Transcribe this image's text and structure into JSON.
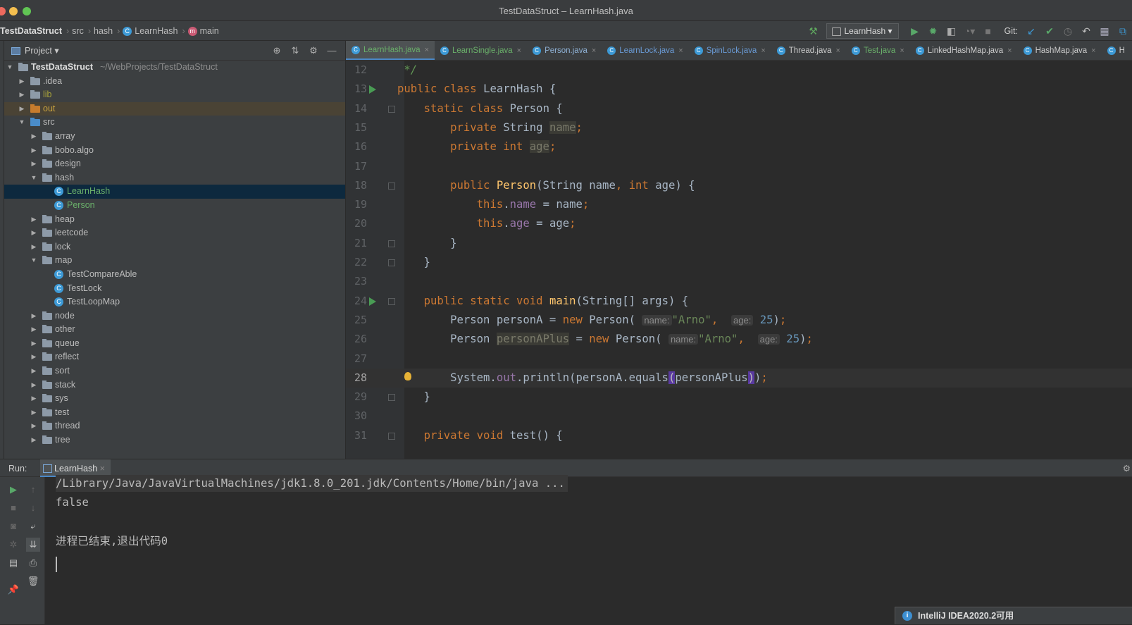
{
  "window": {
    "title": "TestDataStruct – LearnHash.java"
  },
  "navbar": {
    "crumbs": [
      "TestDataStruct",
      "src",
      "hash",
      "LearnHash",
      "main"
    ],
    "run_config": "LearnHash",
    "git_label": "Git:"
  },
  "project": {
    "title": "Project",
    "root": {
      "name": "TestDataStruct",
      "path": "~/WebProjects/TestDataStruct"
    },
    "tree": [
      {
        "label": ".idea",
        "kind": "folder",
        "expanded": false
      },
      {
        "label": "lib",
        "kind": "lib",
        "expanded": false
      },
      {
        "label": "out",
        "kind": "out",
        "expanded": false
      },
      {
        "label": "src",
        "kind": "src",
        "expanded": true
      },
      {
        "label": "array",
        "kind": "pkg",
        "expanded": false
      },
      {
        "label": "bobo.algo",
        "kind": "pkg",
        "expanded": false
      },
      {
        "label": "design",
        "kind": "pkg",
        "expanded": false
      },
      {
        "label": "hash",
        "kind": "pkg",
        "expanded": true
      },
      {
        "label": "LearnHash",
        "kind": "class-main",
        "selected": true
      },
      {
        "label": "Person",
        "kind": "class"
      },
      {
        "label": "heap",
        "kind": "pkg",
        "expanded": false
      },
      {
        "label": "leetcode",
        "kind": "pkg",
        "expanded": false
      },
      {
        "label": "lock",
        "kind": "pkg",
        "expanded": false
      },
      {
        "label": "map",
        "kind": "pkg",
        "expanded": true
      },
      {
        "label": "TestCompareAble",
        "kind": "class-main"
      },
      {
        "label": "TestLock",
        "kind": "class-main"
      },
      {
        "label": "TestLoopMap",
        "kind": "class-main"
      },
      {
        "label": "node",
        "kind": "pkg",
        "expanded": false
      },
      {
        "label": "other",
        "kind": "pkg",
        "expanded": false
      },
      {
        "label": "queue",
        "kind": "pkg",
        "expanded": false
      },
      {
        "label": "reflect",
        "kind": "pkg",
        "expanded": false
      },
      {
        "label": "sort",
        "kind": "pkg",
        "expanded": false
      },
      {
        "label": "stack",
        "kind": "pkg",
        "expanded": false
      },
      {
        "label": "sys",
        "kind": "pkg",
        "expanded": false
      },
      {
        "label": "test",
        "kind": "pkg",
        "expanded": false
      },
      {
        "label": "thread",
        "kind": "pkg",
        "expanded": false
      },
      {
        "label": "tree",
        "kind": "pkg",
        "expanded": false
      }
    ]
  },
  "tabs": [
    {
      "label": "LearnHash.java",
      "active": true
    },
    {
      "label": "LearnSingle.java"
    },
    {
      "label": "Person.java"
    },
    {
      "label": "LearnLock.java"
    },
    {
      "label": "SpinLock.java"
    },
    {
      "label": "Thread.java"
    },
    {
      "label": "Test.java"
    },
    {
      "label": "LinkedHashMap.java"
    },
    {
      "label": "HashMap.java"
    },
    {
      "label": "H"
    }
  ],
  "editor": {
    "current_line": 28,
    "lines": [
      {
        "n": "12",
        "tokens": [
          [
            "cmt",
            " */"
          ]
        ]
      },
      {
        "n": "13",
        "run": true,
        "tokens": [
          [
            "kw",
            "public class "
          ],
          [
            "cls",
            "LearnHash {"
          ]
        ]
      },
      {
        "n": "14",
        "fold": true,
        "tokens": [
          [
            "cls",
            "    "
          ],
          [
            "kw",
            "static class "
          ],
          [
            "cls",
            "Person {"
          ]
        ]
      },
      {
        "n": "15",
        "tokens": [
          [
            "cls",
            "        "
          ],
          [
            "kw",
            "private "
          ],
          [
            "cls",
            "String "
          ],
          [
            "unused",
            "name"
          ],
          [
            "kw",
            ";"
          ]
        ]
      },
      {
        "n": "16",
        "tokens": [
          [
            "cls",
            "        "
          ],
          [
            "kw",
            "private int "
          ],
          [
            "unused",
            "age"
          ],
          [
            "kw",
            ";"
          ]
        ]
      },
      {
        "n": "17",
        "tokens": []
      },
      {
        "n": "18",
        "fold": true,
        "tokens": [
          [
            "cls",
            "        "
          ],
          [
            "kw",
            "public "
          ],
          [
            "fn",
            "Person"
          ],
          [
            "cls",
            "(String name"
          ],
          [
            "kw",
            ", int "
          ],
          [
            "cls",
            "age) {"
          ]
        ]
      },
      {
        "n": "19",
        "tokens": [
          [
            "cls",
            "            "
          ],
          [
            "kw",
            "this"
          ],
          [
            "cls",
            "."
          ],
          [
            "fld",
            "name"
          ],
          [
            "cls",
            " = name"
          ],
          [
            "kw",
            ";"
          ]
        ]
      },
      {
        "n": "20",
        "tokens": [
          [
            "cls",
            "            "
          ],
          [
            "kw",
            "this"
          ],
          [
            "cls",
            "."
          ],
          [
            "fld",
            "age"
          ],
          [
            "cls",
            " = age"
          ],
          [
            "kw",
            ";"
          ]
        ]
      },
      {
        "n": "21",
        "fold": true,
        "tokens": [
          [
            "cls",
            "        }"
          ]
        ]
      },
      {
        "n": "22",
        "fold": true,
        "tokens": [
          [
            "cls",
            "    }"
          ]
        ]
      },
      {
        "n": "23",
        "tokens": []
      },
      {
        "n": "24",
        "run": true,
        "fold": true,
        "tokens": [
          [
            "cls",
            "    "
          ],
          [
            "kw",
            "public static void "
          ],
          [
            "fn",
            "main"
          ],
          [
            "cls",
            "(String[] args) {"
          ]
        ]
      },
      {
        "n": "25",
        "tokens": [
          [
            "cls",
            "        Person personA = "
          ],
          [
            "kw",
            "new "
          ],
          [
            "cls",
            "Person( "
          ],
          [
            "hint",
            "name:"
          ],
          [
            "str",
            "\"Arno\""
          ],
          [
            "kw",
            ",  "
          ],
          [
            "hint",
            "age:"
          ],
          [
            "num",
            " 25"
          ],
          [
            "cls",
            ")"
          ],
          [
            "kw",
            ";"
          ]
        ]
      },
      {
        "n": "26",
        "tokens": [
          [
            "cls",
            "        Person "
          ],
          [
            "unused",
            "personAPlus"
          ],
          [
            "cls",
            " = "
          ],
          [
            "kw",
            "new "
          ],
          [
            "cls",
            "Person( "
          ],
          [
            "hint",
            "name:"
          ],
          [
            "str",
            "\"Arno\""
          ],
          [
            "kw",
            ",  "
          ],
          [
            "hint",
            "age:"
          ],
          [
            "num",
            " 25"
          ],
          [
            "cls",
            ")"
          ],
          [
            "kw",
            ";"
          ]
        ]
      },
      {
        "n": "27",
        "tokens": []
      },
      {
        "n": "28",
        "bulb": true,
        "tokens": [
          [
            "cls",
            "        System."
          ],
          [
            "fld",
            "out"
          ],
          [
            "cls",
            ".println(personA.equals"
          ],
          [
            "brace",
            "("
          ],
          [
            "cls",
            "personAPlus"
          ],
          [
            "brace",
            ")"
          ],
          [
            "cls",
            ")"
          ],
          [
            "kw",
            ";"
          ]
        ]
      },
      {
        "n": "29",
        "fold": true,
        "tokens": [
          [
            "cls",
            "    }"
          ]
        ]
      },
      {
        "n": "30",
        "tokens": []
      },
      {
        "n": "31",
        "fold": true,
        "tokens": [
          [
            "cls",
            "    "
          ],
          [
            "kw",
            "private void "
          ],
          [
            "cls",
            "test() {"
          ]
        ]
      }
    ]
  },
  "run": {
    "label": "Run:",
    "tab": "LearnHash",
    "console": [
      "/Library/Java/JavaVirtualMachines/jdk1.8.0_201.jdk/Contents/Home/bin/java ...",
      "false",
      "",
      "进程已结束,退出代码0"
    ]
  },
  "notification": {
    "text": "IntelliJ IDEA2020.2可用"
  },
  "colors": {
    "keyword": "#cc7832",
    "string": "#6a8759",
    "number": "#6897bb",
    "field": "#9876aa",
    "function": "#ffc66d",
    "selection": "#0d293e",
    "accent": "#4a88c7"
  }
}
